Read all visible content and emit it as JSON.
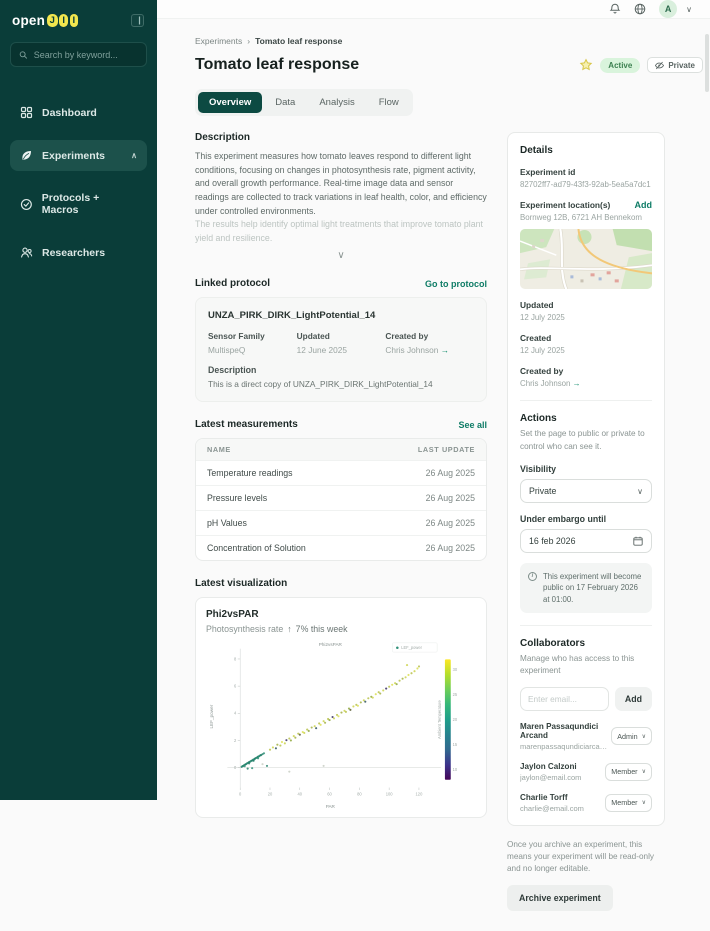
{
  "icons": {
    "breadcrumb_separator": "›",
    "arrow_right": "→",
    "trend_up": "↑",
    "chevron_down": "∨",
    "chevron_up": "∧",
    "info": "i"
  },
  "colors": {
    "sidebar_bg": "#0A3D39",
    "accent_green": "#0E7C66",
    "active_tab_bg": "#0C4A42",
    "active_badge_bg": "#D9F4DC",
    "active_badge_text": "#3C8050",
    "logo_yellow": "#F2E64E"
  },
  "sidebar": {
    "logo_prefix": "open",
    "logo_letters": [
      "J",
      "I",
      "I"
    ],
    "search_placeholder": "Search by keyword...",
    "items": [
      {
        "label": "Dashboard"
      },
      {
        "label": "Experiments",
        "active": true
      },
      {
        "label": "Protocols + Macros"
      },
      {
        "label": "Researchers"
      }
    ]
  },
  "header": {
    "avatar_initial": "A"
  },
  "breadcrumb": {
    "parent": "Experiments",
    "current": "Tomato leaf response"
  },
  "page": {
    "title": "Tomato leaf response",
    "status_badge": "Active",
    "privacy_badge": "Private",
    "tabs": [
      {
        "label": "Overview"
      },
      {
        "label": "Data"
      },
      {
        "label": "Analysis"
      },
      {
        "label": "Flow"
      }
    ]
  },
  "description": {
    "heading": "Description",
    "text": "This experiment measures how tomato leaves respond to different light conditions, focusing on changes in photosynthesis rate, pigment activity, and overall growth performance. Real-time image data and sensor readings are collected to track variations in leaf health, color, and efficiency under controlled environments.",
    "faded_text": "The results help identify optimal light treatments that improve tomato plant yield and resilience."
  },
  "linked_protocol": {
    "heading": "Linked protocol",
    "go_link": "Go to protocol",
    "name": "UNZA_PIRK_DIRK_LightPotential_14",
    "fields": [
      {
        "label": "Sensor Family",
        "value": "MultispeQ"
      },
      {
        "label": "Updated",
        "value": "12 June 2025"
      },
      {
        "label": "Created by",
        "value": "Chris Johnson"
      }
    ],
    "description_label": "Description",
    "description": "This is a direct copy of UNZA_PIRK_DIRK_LightPotential_14"
  },
  "measurements": {
    "heading": "Latest measurements",
    "see_all": "See all",
    "columns": [
      "NAME",
      "LAST UPDATE"
    ],
    "rows": [
      {
        "name": "Temperature readings",
        "last_update": "26 Aug 2025"
      },
      {
        "name": "Pressure levels",
        "last_update": "26 Aug 2025"
      },
      {
        "name": "pH Values",
        "last_update": "26 Aug 2025"
      },
      {
        "name": "Concentration of Solution",
        "last_update": "26 Aug 2025"
      }
    ]
  },
  "visualization": {
    "heading": "Latest visualization",
    "card_title": "Phi2vsPAR",
    "subtitle": "Photosynthesis rate",
    "trend": "7% this week"
  },
  "chart_data": {
    "type": "scatter",
    "title": "Phi2vsPAR",
    "xlabel": "PAR",
    "ylabel": "LEF_power",
    "legend": "LEF_power",
    "xlim": [
      -6,
      127
    ],
    "ylim": [
      -0.9,
      8.4
    ],
    "xticks": [
      0,
      20,
      40,
      60,
      80,
      100,
      120
    ],
    "yticks": [
      0,
      2,
      4,
      6,
      8
    ],
    "colorbar": {
      "label": "Ambient Temperature",
      "range": [
        8,
        32
      ],
      "ticks": [
        10,
        15,
        20,
        25,
        30
      ],
      "colors": [
        "#440556",
        "#3B338B",
        "#31688E",
        "#26828E",
        "#1F9E89",
        "#35B779",
        "#6ECE58",
        "#B5DE2B",
        "#FDE725"
      ]
    },
    "palette": {
      "t1": "#27836D",
      "t2": "#2F9078",
      "t3": "#1F7A65",
      "o1": "#B9C24B",
      "o2": "#CDD34E",
      "o3": "#A3B244",
      "o4": "#DCDF52",
      "o5": "#8FA83C",
      "d1": "#3B2F63",
      "d2": "#31555E",
      "d3": "#5B5D35",
      "g1": "#C9CFC4"
    },
    "points": [
      [
        1,
        0.05,
        "t1"
      ],
      [
        1.5,
        0.1,
        "t2"
      ],
      [
        2,
        0.12,
        "t3"
      ],
      [
        2.5,
        0.16,
        "t1"
      ],
      [
        3,
        0.2,
        "t2"
      ],
      [
        3.5,
        0.22,
        "t1"
      ],
      [
        4,
        0.26,
        "t3"
      ],
      [
        4.5,
        0.3,
        "t2"
      ],
      [
        5,
        0.33,
        "t1"
      ],
      [
        5.5,
        0.36,
        "t2"
      ],
      [
        6,
        0.4,
        "t3"
      ],
      [
        6.5,
        0.42,
        "t1"
      ],
      [
        7,
        0.46,
        "t2"
      ],
      [
        7.5,
        0.5,
        "t1"
      ],
      [
        8,
        0.52,
        "t3"
      ],
      [
        8.5,
        0.56,
        "t2"
      ],
      [
        9,
        0.6,
        "t1"
      ],
      [
        9.5,
        0.62,
        "t2"
      ],
      [
        10,
        0.66,
        "t3"
      ],
      [
        10.5,
        0.7,
        "t1"
      ],
      [
        11,
        0.72,
        "t2"
      ],
      [
        11.5,
        0.76,
        "t1"
      ],
      [
        12,
        0.8,
        "t3"
      ],
      [
        12.5,
        0.82,
        "t2"
      ],
      [
        13,
        0.86,
        "t1"
      ],
      [
        13.5,
        0.9,
        "t2"
      ],
      [
        14,
        0.92,
        "t3"
      ],
      [
        15,
        0.99,
        "t1"
      ],
      [
        16,
        1.05,
        "t2"
      ],
      [
        3,
        0.1,
        "t2"
      ],
      [
        6,
        0.3,
        "t1"
      ],
      [
        9,
        0.5,
        "t3"
      ],
      [
        12,
        0.68,
        "t2"
      ],
      [
        5,
        -0.08,
        "t1"
      ],
      [
        8,
        -0.04,
        "t2"
      ],
      [
        15,
        0.25,
        "g1"
      ],
      [
        18,
        0.12,
        "t1"
      ],
      [
        20,
        1.32,
        "o1"
      ],
      [
        22,
        1.48,
        "o2"
      ],
      [
        24,
        1.42,
        "d2"
      ],
      [
        25,
        1.68,
        "o3"
      ],
      [
        27,
        1.62,
        "o1"
      ],
      [
        28,
        1.88,
        "o4"
      ],
      [
        30,
        1.78,
        "o2"
      ],
      [
        31,
        2.02,
        "d1"
      ],
      [
        33,
        2.14,
        "o1"
      ],
      [
        34,
        2.0,
        "o5"
      ],
      [
        36,
        2.32,
        "o2"
      ],
      [
        37,
        2.2,
        "o3"
      ],
      [
        39,
        2.5,
        "o1"
      ],
      [
        40,
        2.42,
        "d3"
      ],
      [
        42,
        2.62,
        "o4"
      ],
      [
        43,
        2.55,
        "o2"
      ],
      [
        45,
        2.8,
        "o1"
      ],
      [
        46,
        2.7,
        "o5"
      ],
      [
        48,
        2.95,
        "o3"
      ],
      [
        50,
        3.05,
        "o2"
      ],
      [
        51,
        2.9,
        "d2"
      ],
      [
        53,
        3.25,
        "o1"
      ],
      [
        54,
        3.15,
        "o4"
      ],
      [
        56,
        3.42,
        "o2"
      ],
      [
        57,
        3.3,
        "o3"
      ],
      [
        59,
        3.58,
        "o1"
      ],
      [
        60,
        3.5,
        "o5"
      ],
      [
        62,
        3.72,
        "d1"
      ],
      [
        63,
        3.62,
        "o2"
      ],
      [
        65,
        3.88,
        "o1"
      ],
      [
        66,
        3.78,
        "o4"
      ],
      [
        68,
        4.05,
        "o3"
      ],
      [
        70,
        4.18,
        "o2"
      ],
      [
        71,
        4.1,
        "o1"
      ],
      [
        73,
        4.35,
        "o5"
      ],
      [
        74,
        4.25,
        "d3"
      ],
      [
        76,
        4.5,
        "o2"
      ],
      [
        78,
        4.62,
        "o1"
      ],
      [
        79,
        4.55,
        "o4"
      ],
      [
        81,
        4.8,
        "o3"
      ],
      [
        83,
        4.95,
        "o2"
      ],
      [
        84,
        4.85,
        "d2"
      ],
      [
        86,
        5.1,
        "o1"
      ],
      [
        88,
        5.22,
        "o5"
      ],
      [
        89,
        5.15,
        "o2"
      ],
      [
        91,
        5.4,
        "o4"
      ],
      [
        93,
        5.55,
        "o1"
      ],
      [
        94,
        5.45,
        "o3"
      ],
      [
        96,
        5.68,
        "o2"
      ],
      [
        98,
        5.82,
        "d1"
      ],
      [
        100,
        5.95,
        "o1"
      ],
      [
        102,
        6.1,
        "o4"
      ],
      [
        104,
        6.22,
        "o2"
      ],
      [
        105,
        6.15,
        "o5"
      ],
      [
        107,
        6.4,
        "o1"
      ],
      [
        109,
        6.55,
        "o3"
      ],
      [
        111,
        6.65,
        "o2"
      ],
      [
        112,
        7.55,
        "o2"
      ],
      [
        113,
        6.82,
        "o4"
      ],
      [
        115,
        6.95,
        "o1"
      ],
      [
        117,
        7.1,
        "o2"
      ],
      [
        119,
        7.3,
        "o4"
      ],
      [
        120,
        7.45,
        "o1"
      ],
      [
        33,
        -0.3,
        "g1"
      ],
      [
        56,
        0.12,
        "g1"
      ]
    ]
  },
  "details": {
    "heading": "Details",
    "experiment_id_label": "Experiment id",
    "experiment_id": "82702ff7-ad79-43f3-92ab-5ea5a7dc1",
    "location_label": "Experiment location(s)",
    "add_link": "Add",
    "location_value": "Bornweg 12B, 6721 AH Bennekom",
    "updated_label": "Updated",
    "updated_value": "12 July 2025",
    "created_label": "Created",
    "created_value": "12 July 2025",
    "created_by_label": "Created by",
    "created_by_value": "Chris Johnson"
  },
  "actions": {
    "heading": "Actions",
    "subtext": "Set the page to public or private to control who can see it.",
    "visibility_label": "Visibility",
    "visibility_value": "Private",
    "embargo_label": "Under embargo until",
    "embargo_value": "16 feb 2026",
    "info_text": "This experiment will become public on 17 February 2026 at 01:00."
  },
  "collaborators": {
    "heading": "Collaborators",
    "subtext": "Manage who has access to this experiment",
    "email_placeholder": "Enter email...",
    "add_button": "Add",
    "people": [
      {
        "name": "Maren Passaqundici Arcand",
        "email": "marenpassaqundiciarcand@em...",
        "role": "Admin"
      },
      {
        "name": "Jaylon Calzoni",
        "email": "jaylon@email.com",
        "role": "Member"
      },
      {
        "name": "Charlie Torff",
        "email": "charlie@email.com",
        "role": "Member"
      }
    ]
  },
  "archive": {
    "note": "Once you archive an experiment, this means your experiment will be read-only and no longer editable.",
    "button_label": "Archive experiment"
  }
}
